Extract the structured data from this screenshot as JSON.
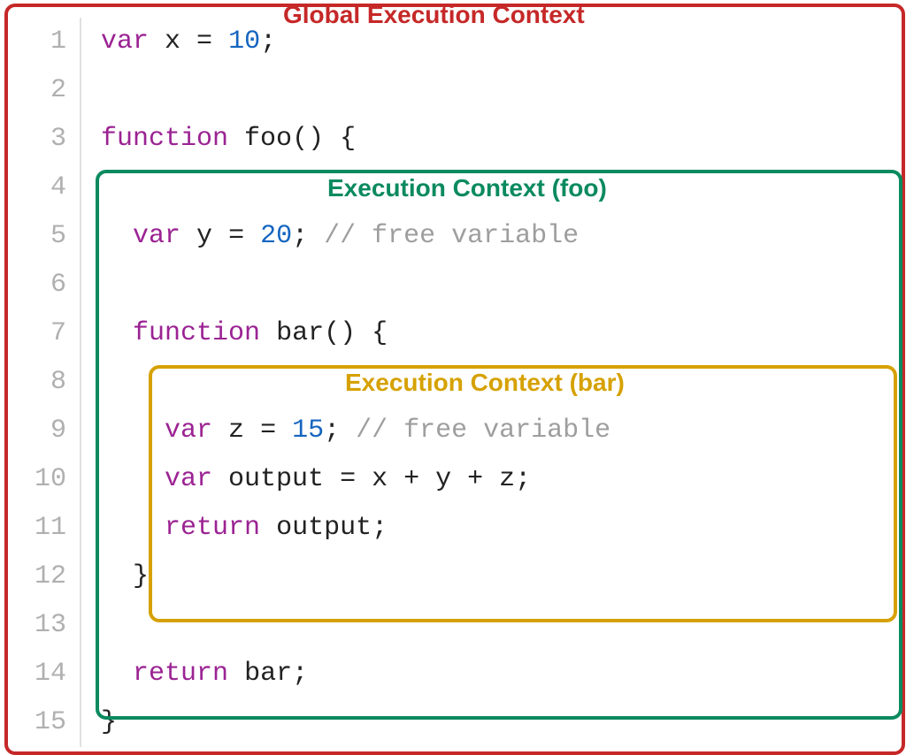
{
  "labels": {
    "global": "Global Execution Context",
    "foo": "Execution Context (foo)",
    "bar": "Execution Context (bar)"
  },
  "line_numbers": [
    "1",
    "2",
    "3",
    "4",
    "5",
    "6",
    "7",
    "8",
    "9",
    "10",
    "11",
    "12",
    "13",
    "14",
    "15"
  ],
  "code": {
    "l1": [
      {
        "cls": "kw",
        "t": "var"
      },
      {
        "cls": "punct",
        "t": " "
      },
      {
        "cls": "ident",
        "t": "x"
      },
      {
        "cls": "punct",
        "t": " = "
      },
      {
        "cls": "num",
        "t": "10"
      },
      {
        "cls": "punct",
        "t": ";"
      }
    ],
    "l2": [],
    "l3": [
      {
        "cls": "kw",
        "t": "function"
      },
      {
        "cls": "punct",
        "t": " "
      },
      {
        "cls": "ident",
        "t": "foo"
      },
      {
        "cls": "punct",
        "t": "() {"
      }
    ],
    "l4": [],
    "l5": [
      {
        "cls": "punct",
        "t": "  "
      },
      {
        "cls": "kw",
        "t": "var"
      },
      {
        "cls": "punct",
        "t": " "
      },
      {
        "cls": "ident",
        "t": "y"
      },
      {
        "cls": "punct",
        "t": " = "
      },
      {
        "cls": "num",
        "t": "20"
      },
      {
        "cls": "punct",
        "t": "; "
      },
      {
        "cls": "comment",
        "t": "// free variable"
      }
    ],
    "l6": [],
    "l7": [
      {
        "cls": "punct",
        "t": "  "
      },
      {
        "cls": "kw",
        "t": "function"
      },
      {
        "cls": "punct",
        "t": " "
      },
      {
        "cls": "ident",
        "t": "bar"
      },
      {
        "cls": "punct",
        "t": "() {"
      }
    ],
    "l8": [],
    "l9": [
      {
        "cls": "punct",
        "t": "    "
      },
      {
        "cls": "kw",
        "t": "var"
      },
      {
        "cls": "punct",
        "t": " "
      },
      {
        "cls": "ident",
        "t": "z"
      },
      {
        "cls": "punct",
        "t": " = "
      },
      {
        "cls": "num",
        "t": "15"
      },
      {
        "cls": "punct",
        "t": "; "
      },
      {
        "cls": "comment",
        "t": "// free variable"
      }
    ],
    "l10": [
      {
        "cls": "punct",
        "t": "    "
      },
      {
        "cls": "kw",
        "t": "var"
      },
      {
        "cls": "punct",
        "t": " "
      },
      {
        "cls": "ident",
        "t": "output"
      },
      {
        "cls": "punct",
        "t": " = "
      },
      {
        "cls": "ident",
        "t": "x"
      },
      {
        "cls": "punct",
        "t": " + "
      },
      {
        "cls": "ident",
        "t": "y"
      },
      {
        "cls": "punct",
        "t": " + "
      },
      {
        "cls": "ident",
        "t": "z"
      },
      {
        "cls": "punct",
        "t": ";"
      }
    ],
    "l11": [
      {
        "cls": "punct",
        "t": "    "
      },
      {
        "cls": "kw",
        "t": "return"
      },
      {
        "cls": "punct",
        "t": " "
      },
      {
        "cls": "ident",
        "t": "output"
      },
      {
        "cls": "punct",
        "t": ";"
      }
    ],
    "l12": [
      {
        "cls": "punct",
        "t": "  }"
      }
    ],
    "l13": [],
    "l14": [
      {
        "cls": "punct",
        "t": "  "
      },
      {
        "cls": "kw",
        "t": "return"
      },
      {
        "cls": "punct",
        "t": " "
      },
      {
        "cls": "ident",
        "t": "bar"
      },
      {
        "cls": "punct",
        "t": ";"
      }
    ],
    "l15": [
      {
        "cls": "punct",
        "t": "}"
      }
    ]
  },
  "colors": {
    "global_border": "#c62828",
    "foo_border": "#0b8a5f",
    "bar_border": "#d6a100"
  }
}
